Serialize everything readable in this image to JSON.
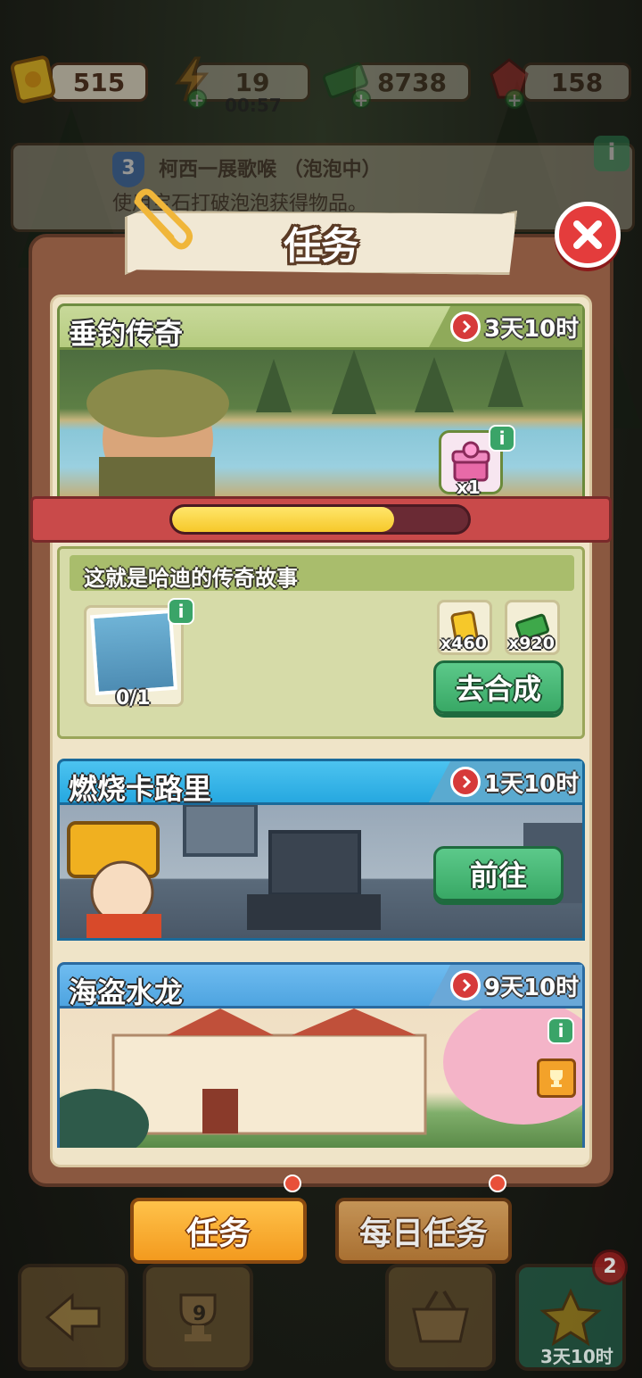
{
  "resources": {
    "tickets": "515",
    "energy": "19",
    "energy_timer": "00:57",
    "cash": "8738",
    "gems": "158"
  },
  "background_quest": {
    "level": "3",
    "title": "柯西一展歌喉 （泡泡中）",
    "desc": "使用宝石打破泡泡获得物品。",
    "info_label": "i"
  },
  "dialog": {
    "title": "任务",
    "close_label": "✕"
  },
  "tasks": [
    {
      "name": "垂钓传奇",
      "timer": "3天10时",
      "chest_qty": "x1",
      "progress": 0.75,
      "subtask": {
        "title": "这就是哈迪的传奇故事",
        "progress_text": "0/1",
        "rewards": [
          {
            "icon": "ticket-icon",
            "qty": "x460"
          },
          {
            "icon": "cash-icon",
            "qty": "x920"
          }
        ],
        "button_label": "去合成"
      }
    },
    {
      "name": "燃烧卡路里",
      "timer": "1天10时",
      "button_label": "前往"
    },
    {
      "name": "海盗水龙",
      "timer": "9天10时"
    }
  ],
  "tabs": {
    "tasks": "任务",
    "daily": "每日任务"
  },
  "bottom_nav": {
    "trophy_count": "9",
    "badge_count": "2",
    "event_timer": "3天10时"
  },
  "colors": {
    "accent_green": "#3aa468",
    "panel_brown": "#8a5840",
    "tab_orange": "#f39a1e",
    "close_red": "#e43c3c"
  }
}
